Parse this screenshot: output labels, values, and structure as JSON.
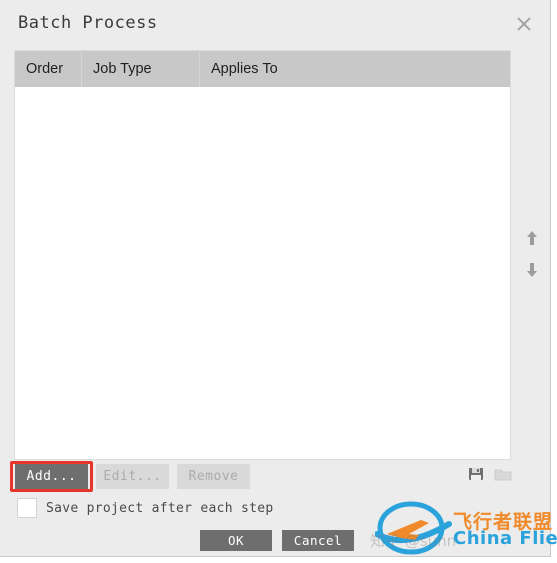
{
  "dialog": {
    "title": "Batch Process",
    "close_icon": "close-icon"
  },
  "table": {
    "columns": [
      "Order",
      "Job Type",
      "Applies To"
    ],
    "rows": []
  },
  "reorder": {
    "move_up_icon": "arrow-up-icon",
    "move_down_icon": "arrow-down-icon"
  },
  "actions": {
    "add_label": "Add...",
    "edit_label": "Edit...",
    "remove_label": "Remove",
    "highlight_color": "#e8352a"
  },
  "file_icons": {
    "save_icon": "save-disk-icon",
    "open_icon": "open-folder-icon"
  },
  "options": {
    "save_project_label": "Save project after each step",
    "save_project_checked": false
  },
  "footer": {
    "ok_label": "OK",
    "cancel_label": "Cancel"
  },
  "watermark": {
    "text_cn": "飞行者联盟",
    "text_en": "China Flier",
    "zhihu": "知乎 @sunn",
    "brand_orange": "#f08a2a",
    "brand_blue": "#2aa3dd"
  }
}
